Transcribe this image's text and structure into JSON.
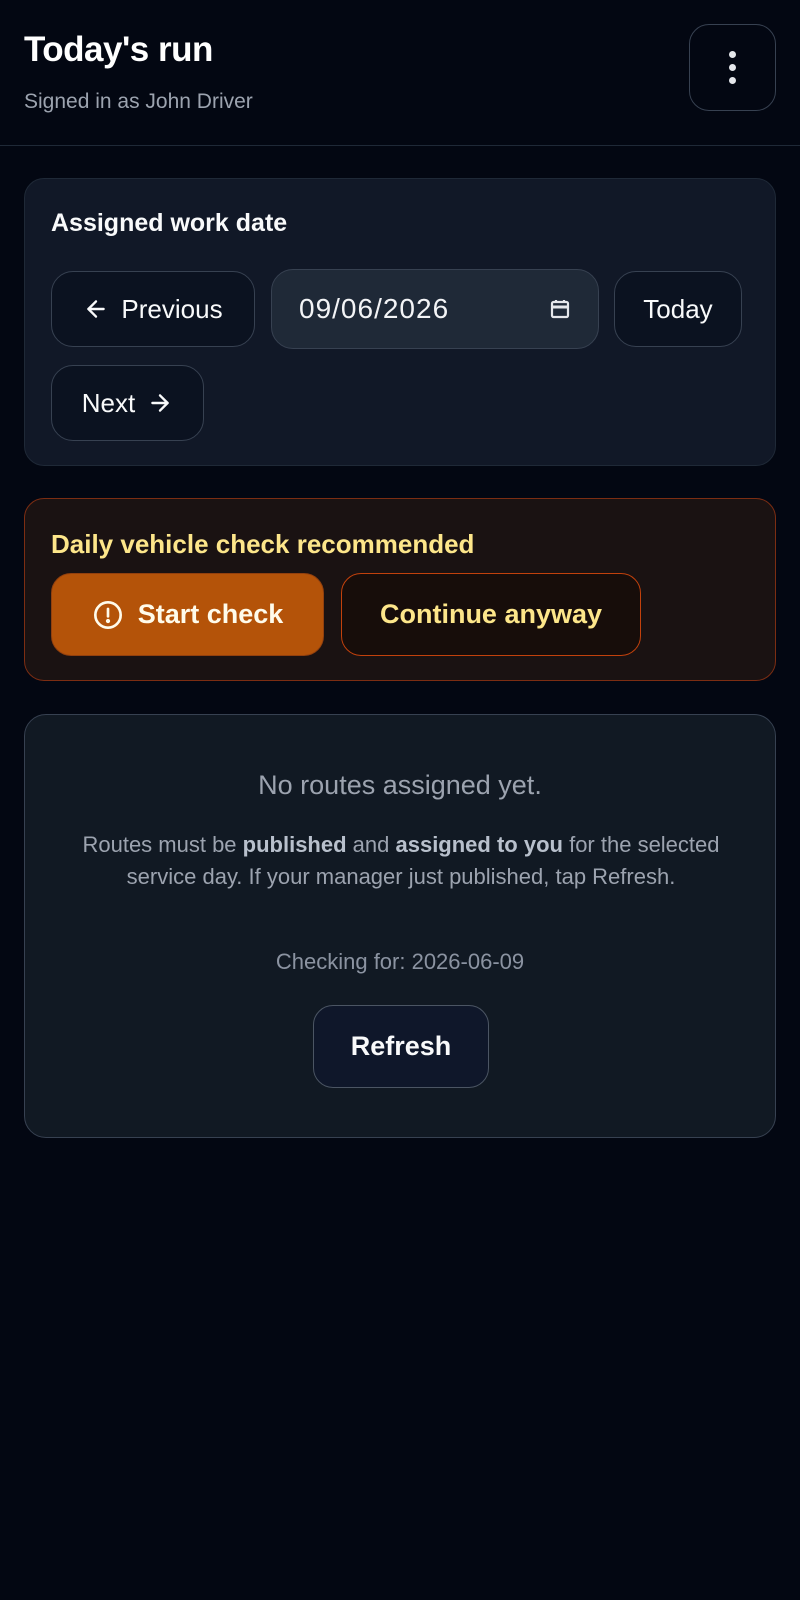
{
  "header": {
    "title": "Today's run",
    "subtitle": "Signed in as John Driver",
    "menu_icon": "more-vertical-icon"
  },
  "date_picker": {
    "title": "Assigned work date",
    "previous_label": "Previous",
    "previous_icon": "arrow-left-icon",
    "date_value": "09/06/2026",
    "calendar_icon": "calendar-icon",
    "today_label": "Today",
    "next_label": "Next",
    "next_icon": "arrow-right-icon"
  },
  "vehicle_check": {
    "title": "Daily vehicle check recommended",
    "start_label": "Start check",
    "start_icon": "alert-circle-icon",
    "continue_label": "Continue anyway",
    "accent_color": "#b45309",
    "title_color": "#fde68a"
  },
  "empty_state": {
    "title": "No routes assigned yet.",
    "desc_part1": "Routes must be ",
    "desc_bold1": "published",
    "desc_part2": " and ",
    "desc_bold2": "assigned to you",
    "desc_part3": " for the selected service day. If your manager just published, tap Refresh.",
    "checking_text": "Checking for: 2026-06-09",
    "refresh_label": "Refresh"
  }
}
